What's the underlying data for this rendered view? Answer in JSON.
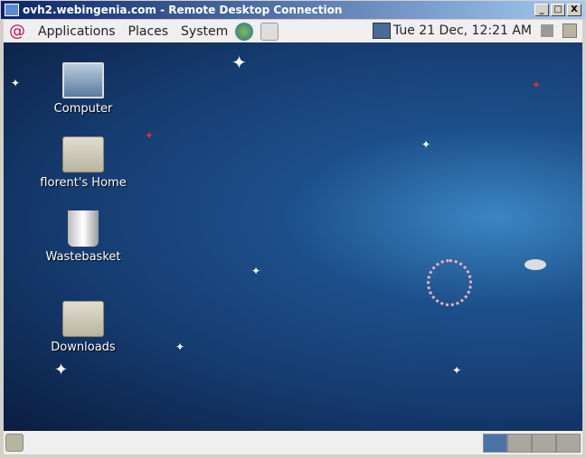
{
  "window": {
    "title": "ovh2.webingenia.com - Remote Desktop Connection",
    "buttons": [
      "_",
      "□",
      "X"
    ]
  },
  "top_panel": {
    "menus": [
      "Applications",
      "Places",
      "System"
    ],
    "clock": "Tue 21 Dec, 12:21 AM"
  },
  "desktop": {
    "icons": [
      {
        "label": "Computer"
      },
      {
        "label": "florent's Home"
      },
      {
        "label": "Wastebasket"
      },
      {
        "label": "Downloads"
      }
    ]
  },
  "bottom_panel": {
    "workspaces": 4,
    "active_workspace": 1,
    "active_color": "#4a74a8"
  }
}
